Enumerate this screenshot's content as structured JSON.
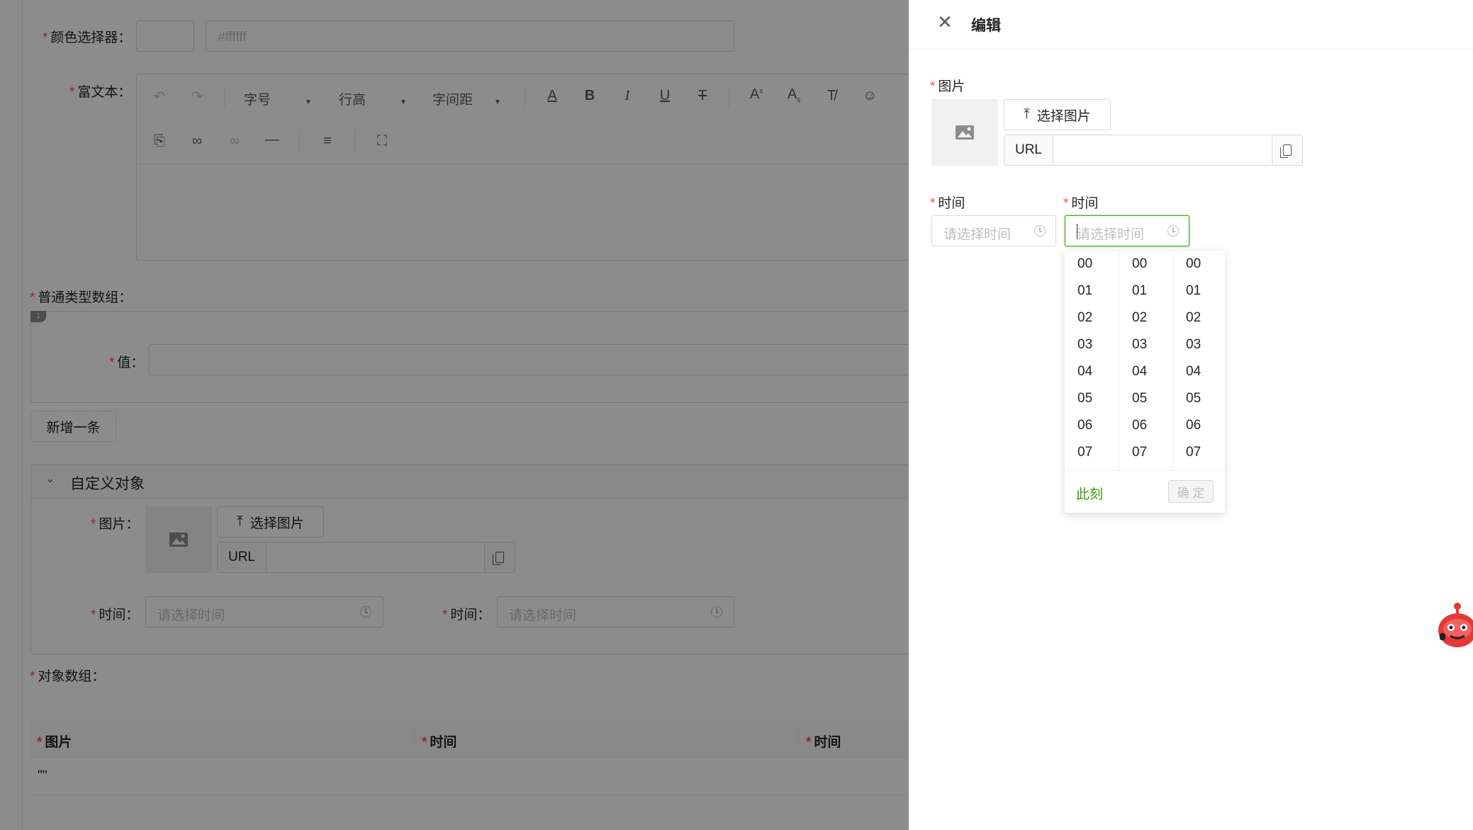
{
  "bg": {
    "color_picker": {
      "label": "颜色选择器：",
      "value": "#ffffff"
    },
    "rich_text": {
      "label": "富文本：",
      "font_size": "字号",
      "line_height": "行高",
      "letter_spacing": "字间距"
    },
    "plain_array": {
      "label": "普通类型数组：",
      "index_badge": "1",
      "value_label": "值：",
      "add_button": "新增一条"
    },
    "custom_object": {
      "title": "自定义对象",
      "image_label": "图片：",
      "select_image": "选择图片",
      "url_addon": "URL",
      "time_label_1": "时间：",
      "time_label_2": "时间：",
      "time_placeholder": "请选择时间"
    },
    "object_array": {
      "label": "对象数组：",
      "columns": [
        "图片",
        "时间",
        "时间"
      ],
      "row_value": "\"\""
    }
  },
  "drawer": {
    "title": "编辑",
    "image_label": "图片",
    "select_image": "选择图片",
    "url_addon": "URL",
    "time_label_1": "时间",
    "time_label_2": "时间",
    "time_placeholder": "请选择时间"
  },
  "time_picker": {
    "hours": [
      "00",
      "01",
      "02",
      "03",
      "04",
      "05",
      "06",
      "07"
    ],
    "minutes": [
      "00",
      "01",
      "02",
      "03",
      "04",
      "05",
      "06",
      "07"
    ],
    "seconds": [
      "00",
      "01",
      "02",
      "03",
      "04",
      "05",
      "06",
      "07"
    ],
    "now_label": "此刻",
    "ok_label": "确 定"
  },
  "colors": {
    "primary": "#389e0d",
    "required": "#ff4d4f",
    "mask": "rgba(0,0,0,0.45)"
  }
}
